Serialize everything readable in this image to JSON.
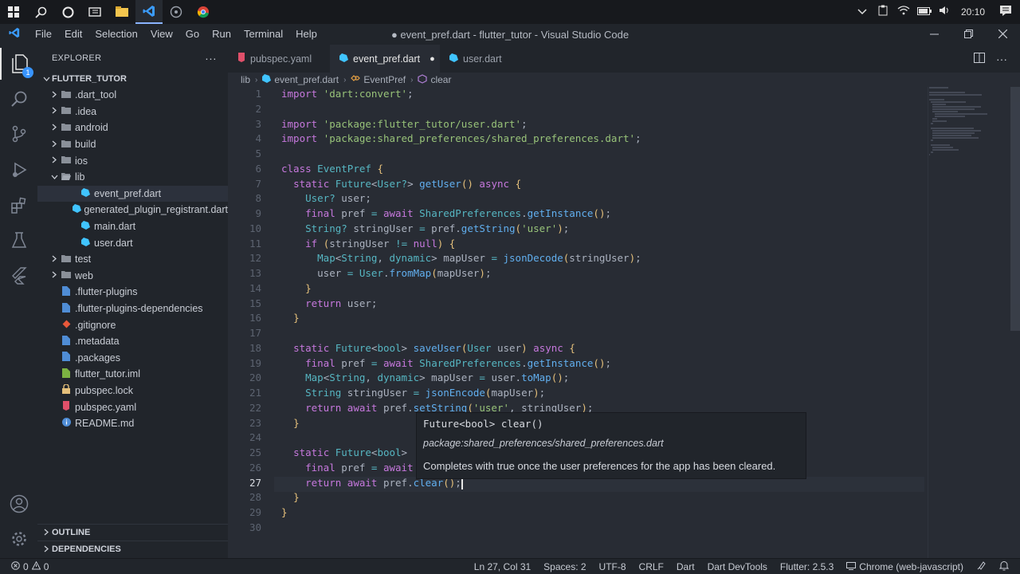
{
  "taskbar": {
    "icons": [
      "windows-start-icon",
      "search-icon",
      "cortana-icon",
      "task-view-icon",
      "file-explorer-icon",
      "vscode-icon",
      "gallery-icon",
      "chrome-icon"
    ],
    "tray": [
      "chevron-up-icon",
      "clipboard-icon",
      "wifi-icon",
      "battery-icon",
      "volume-icon"
    ],
    "clock": "20:10"
  },
  "titlebar": {
    "menu": [
      "File",
      "Edit",
      "Selection",
      "View",
      "Go",
      "Run",
      "Terminal",
      "Help"
    ],
    "window_title": "● event_pref.dart - flutter_tutor - Visual Studio Code"
  },
  "sidebar": {
    "header": "EXPLORER",
    "project": "FLUTTER_TUTOR",
    "tree": [
      {
        "label": ".dart_tool",
        "type": "folder"
      },
      {
        "label": ".idea",
        "type": "folder"
      },
      {
        "label": "android",
        "type": "folder"
      },
      {
        "label": "build",
        "type": "folder"
      },
      {
        "label": "ios",
        "type": "folder"
      },
      {
        "label": "lib",
        "type": "folder-open"
      },
      {
        "label": "event_pref.dart",
        "type": "dart",
        "indent": 2
      },
      {
        "label": "generated_plugin_registrant.dart",
        "type": "dart",
        "indent": 2
      },
      {
        "label": "main.dart",
        "type": "dart",
        "indent": 2
      },
      {
        "label": "user.dart",
        "type": "dart",
        "indent": 2
      },
      {
        "label": "test",
        "type": "folder"
      },
      {
        "label": "web",
        "type": "folder"
      },
      {
        "label": ".flutter-plugins",
        "type": "file"
      },
      {
        "label": ".flutter-plugins-dependencies",
        "type": "file"
      },
      {
        "label": ".gitignore",
        "type": "git"
      },
      {
        "label": ".metadata",
        "type": "file"
      },
      {
        "label": ".packages",
        "type": "file"
      },
      {
        "label": "flutter_tutor.iml",
        "type": "iml"
      },
      {
        "label": "pubspec.lock",
        "type": "lock"
      },
      {
        "label": "pubspec.yaml",
        "type": "yaml"
      },
      {
        "label": "README.md",
        "type": "info"
      }
    ],
    "outline": "OUTLINE",
    "dependencies": "DEPENDENCIES"
  },
  "tabs": [
    {
      "label": "pubspec.yaml",
      "active": false
    },
    {
      "label": "event_pref.dart",
      "active": true
    },
    {
      "label": "user.dart",
      "active": false
    }
  ],
  "breadcrumb": {
    "folder": "lib",
    "file": "event_pref.dart",
    "class": "EventPref",
    "method": "clear"
  },
  "editor": {
    "current_line": 27,
    "lines": [
      "import 'dart:convert';",
      "",
      "import 'package:flutter_tutor/user.dart';",
      "import 'package:shared_preferences/shared_preferences.dart';",
      "",
      "class EventPref {",
      "  static Future<User?> getUser() async {",
      "    User? user;",
      "    final pref = await SharedPreferences.getInstance();",
      "    String? stringUser = pref.getString('user');",
      "    if (stringUser != null) {",
      "      Map<String, dynamic> mapUser = jsonDecode(stringUser);",
      "      user = User.fromMap(mapUser);",
      "    }",
      "    return user;",
      "  }",
      "",
      "  static Future<bool> saveUser(User user) async {",
      "    final pref = await SharedPreferences.getInstance();",
      "    Map<String, dynamic> mapUser = user.toMap();",
      "    String stringUser = jsonEncode(mapUser);",
      "    return await pref.setString('user', stringUser);",
      "  }",
      "",
      "  static Future<bool> ",
      "    final pref = await ",
      "    return await pref.clear();",
      "  }",
      "}",
      ""
    ]
  },
  "hover": {
    "signature": "Future<bool> clear()",
    "package": "package:shared_preferences/shared_preferences.dart",
    "doc": "Completes with true once the user preferences for the app has been cleared."
  },
  "statusbar": {
    "errors": "0",
    "warnings": "0",
    "position": "Ln 27, Col 31",
    "spaces": "Spaces: 2",
    "encoding": "UTF-8",
    "eol": "CRLF",
    "language": "Dart",
    "devtools": "Dart DevTools",
    "flutter": "Flutter: 2.5.3",
    "device": "Chrome (web-javascript)"
  },
  "colors": {
    "accent": "#3794ff",
    "keyword": "#c678dd",
    "string": "#98c379",
    "type": "#61afef"
  }
}
